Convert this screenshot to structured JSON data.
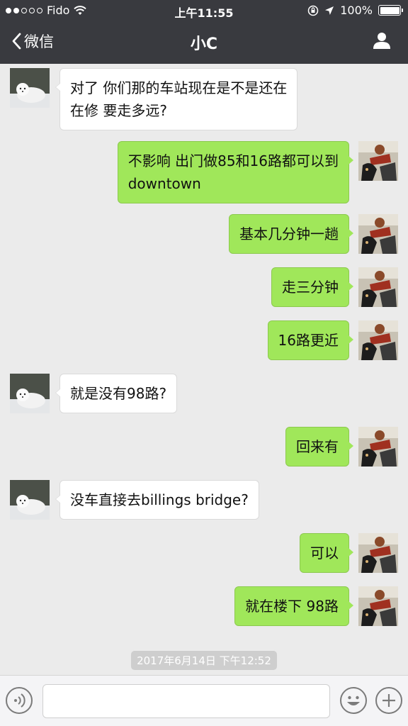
{
  "status_bar": {
    "carrier": "Fido",
    "time": "上午11:55",
    "battery_percent": "100%",
    "signal_bars_filled": 2,
    "signal_bars_total": 5,
    "battery_level": 1.0
  },
  "nav": {
    "back_label": "微信",
    "title": "小C",
    "back_icon": "chevron-left-icon",
    "profile_icon": "person-icon"
  },
  "messages": [
    {
      "from": "contact",
      "text1": "对了 你们那的车站现在是不是还在",
      "text2": "在修 要走多远?"
    },
    {
      "from": "me",
      "text1": "不影响 出门做85和16路都可以到",
      "text2": "downtown"
    },
    {
      "from": "me",
      "text1": "基本几分钟一趟"
    },
    {
      "from": "me",
      "text1": "走三分钟"
    },
    {
      "from": "me",
      "text1": "16路更近"
    },
    {
      "from": "contact",
      "text1": "就是没有98路?"
    },
    {
      "from": "me",
      "text1": "回来有"
    },
    {
      "from": "contact",
      "text1": "没车直接去billings bridge?"
    },
    {
      "from": "me",
      "text1": "可以"
    },
    {
      "from": "me",
      "text1": "就在楼下 98路"
    }
  ],
  "timestamp": "2017年6月14日 下午12:52",
  "input_bar": {
    "voice_icon": "voice-icon",
    "emoji_icon": "emoji-icon",
    "plus_icon": "plus-icon",
    "input_value": ""
  },
  "colors": {
    "nav_bg": "#393a3f",
    "chat_bg": "#ebebeb",
    "outgoing_bubble": "#a0e75a",
    "incoming_bubble": "#ffffff"
  }
}
